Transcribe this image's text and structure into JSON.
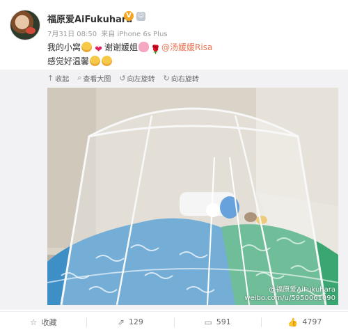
{
  "author": {
    "name": "福原爱AiFukuhara",
    "vip_badge": "V"
  },
  "meta": {
    "time": "7月31日 08:50",
    "source_prefix": "来自",
    "source": "iPhone 6s Plus"
  },
  "post": {
    "line1_a": "我的小窝",
    "line1_b": "谢谢媛姐",
    "mention": "@汤媛媛Risa",
    "line2": "感觉好温馨"
  },
  "media_toolbar": {
    "collapse": "收起",
    "view_large": "查看大图",
    "rotate_left": "向左旋转",
    "rotate_right": "向右旋转"
  },
  "watermark": {
    "line1": "@福原爱AiFukuhara",
    "line2": "weibo.com/u/5950061090"
  },
  "actions": {
    "favorite": "收藏",
    "repost_count": "129",
    "comment_count": "591",
    "like_count": "4797"
  },
  "colors": {
    "mention": "#eb7350",
    "vip": "#f5a623"
  }
}
